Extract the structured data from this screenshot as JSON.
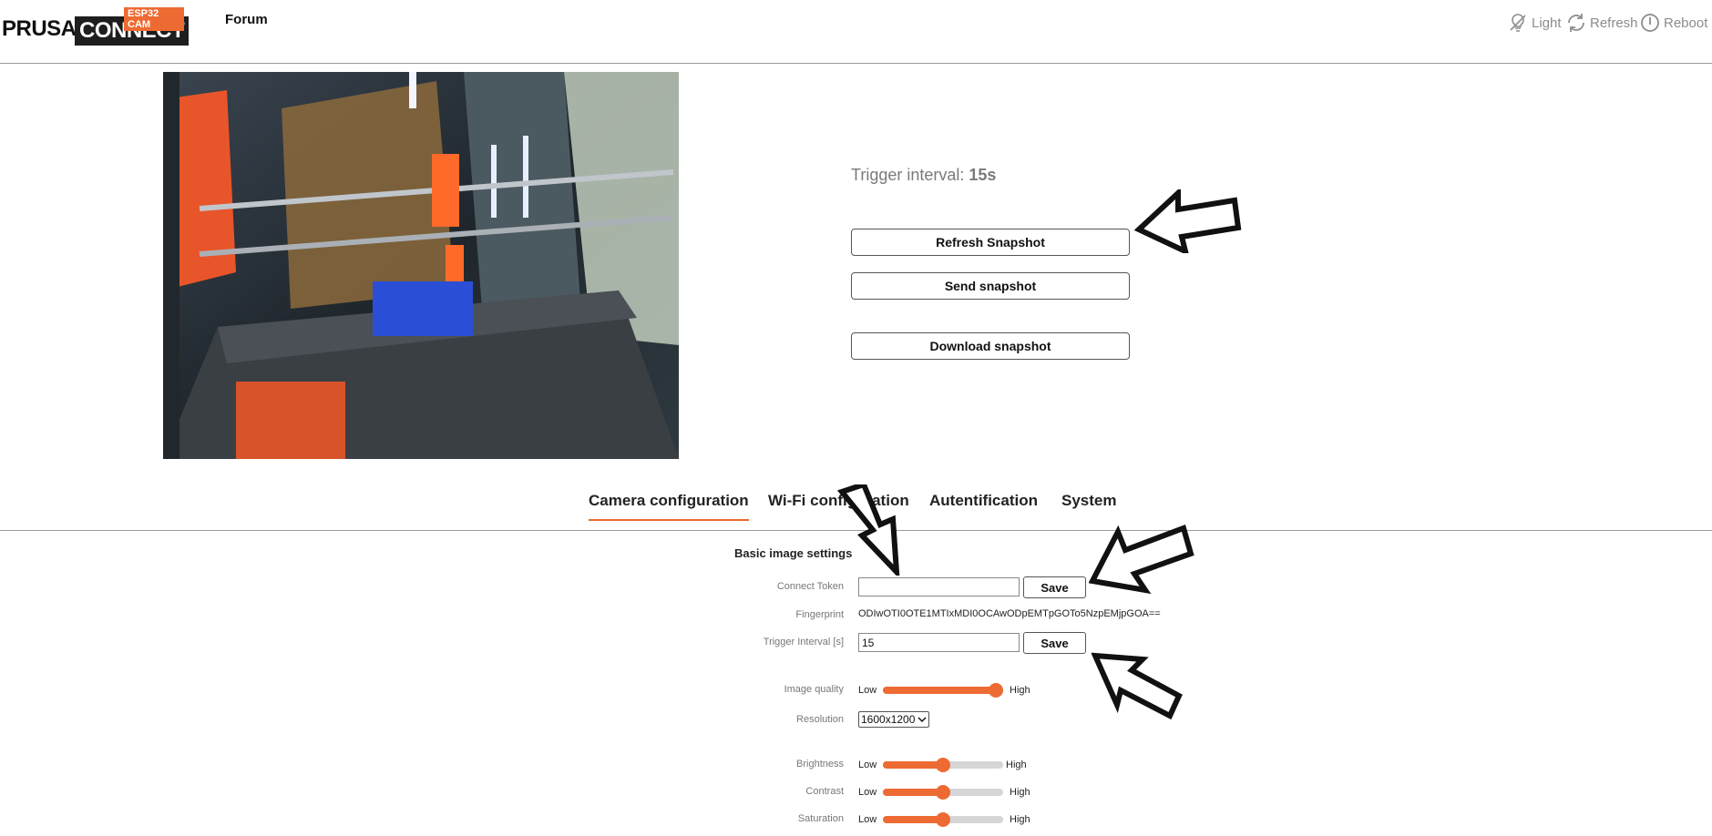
{
  "header": {
    "logo_prusa": "PRUSA",
    "logo_connect": "CONNECT",
    "logo_badge": "ESP32 CAM",
    "forum": "Forum",
    "actions": {
      "light": "Light",
      "refresh": "Refresh",
      "reboot": "Reboot"
    }
  },
  "main": {
    "trigger_label": "Trigger interval: ",
    "trigger_value": "15s",
    "buttons": {
      "refresh_snapshot": "Refresh Snapshot",
      "send_snapshot": "Send snapshot",
      "download_snapshot": "Download snapshot"
    }
  },
  "tabs": [
    {
      "label": "Camera configuration",
      "active": true
    },
    {
      "label": "Wi-Fi configuration",
      "active": false
    },
    {
      "label": "Autentification",
      "active": false
    },
    {
      "label": "System",
      "active": false
    }
  ],
  "settings": {
    "section_title": "Basic image settings",
    "connect_token": {
      "label": "Connect Token",
      "value": "",
      "save": "Save"
    },
    "fingerprint": {
      "label": "Fingerprint",
      "value": "ODIwOTI0OTE1MTIxMDI0OCAwODpEMTpGOTo5NzpEMjpGOA=="
    },
    "trigger_interval": {
      "label": "Trigger Interval [s]",
      "value": "15",
      "save": "Save"
    },
    "image_quality": {
      "label": "Image quality",
      "low": "Low",
      "high": "High",
      "level": 1.0
    },
    "resolution": {
      "label": "Resolution",
      "value": "1600x1200"
    },
    "brightness": {
      "label": "Brightness",
      "low": "Low",
      "high": "High",
      "level": 0.5
    },
    "contrast": {
      "label": "Contrast",
      "low": "Low",
      "high": "High",
      "level": 0.5
    },
    "saturation": {
      "label": "Saturation",
      "low": "Low",
      "high": "High",
      "level": 0.5
    }
  },
  "colors": {
    "accent": "#ed6b33",
    "text_muted": "#7a7a7a"
  }
}
